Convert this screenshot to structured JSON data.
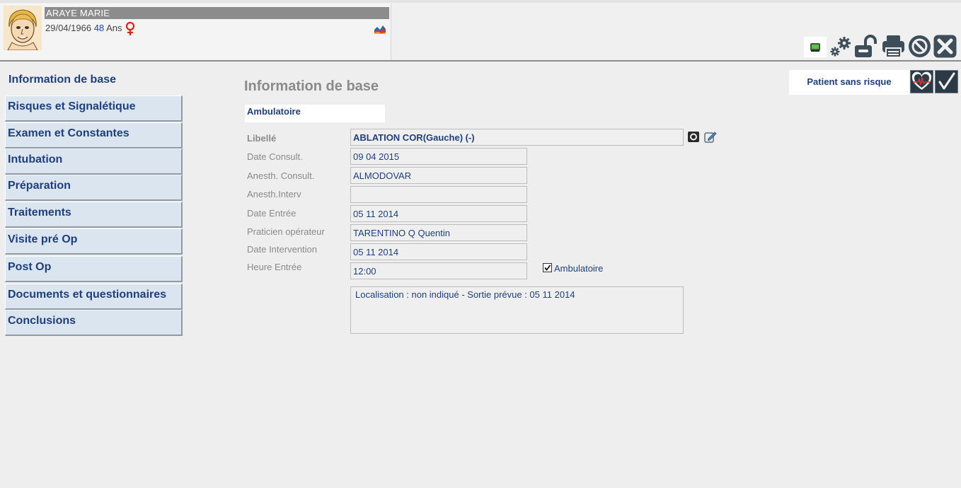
{
  "patient": {
    "name": "ARAYE  MARIE",
    "dob": "29/04/1966",
    "age": "48",
    "age_unit": "Ans"
  },
  "toolbar": {
    "icons": [
      "tablet-icon",
      "settings-icon",
      "unlock-icon",
      "print-icon",
      "cancel-icon",
      "close-icon"
    ]
  },
  "sidebar": {
    "header": "Information de base",
    "items": [
      {
        "label": "Risques et Signalétique"
      },
      {
        "label": "Examen et Constantes"
      },
      {
        "label": "Intubation"
      },
      {
        "label": "Préparation"
      },
      {
        "label": "Traitements"
      },
      {
        "label": "Visite pré Op"
      },
      {
        "label": "Post Op"
      },
      {
        "label": "Documents et questionnaires"
      },
      {
        "label": "Conclusions"
      }
    ]
  },
  "main": {
    "title": "Information de base",
    "mode": "Ambulatoire",
    "risk_label": "Patient sans risque",
    "fields": {
      "libelle": {
        "label": "Libellé",
        "value": "ABLATION COR(Gauche) (-)"
      },
      "date_consult": {
        "label": "Date Consult.",
        "value": "09 04 2015"
      },
      "anesth_consult": {
        "label": "Anesth. Consult.",
        "value": "ALMODOVAR"
      },
      "anesth_interv": {
        "label": "Anesth.Interv",
        "value": ""
      },
      "date_entree": {
        "label": "Date Entrée",
        "value": "05 11 2014"
      },
      "praticien": {
        "label": "Praticien opérateur",
        "value": "TARENTINO Q Quentin"
      },
      "date_intervention": {
        "label": "Date Intervention",
        "value": "05 11 2014"
      },
      "heure_entree": {
        "label": "Heure Entrée",
        "value": "12:00"
      }
    },
    "ambulatoire_checkbox": {
      "label": "Ambulatoire",
      "checked": true
    },
    "memo": "Localisation : non indiqué  - Sortie prévue : 05 11 2014"
  },
  "colors": {
    "accent": "#1f3f7a",
    "nav_bg": "#dbe5ef",
    "label_gray": "#8a8a8a",
    "female_red": "#cc2a1a"
  }
}
